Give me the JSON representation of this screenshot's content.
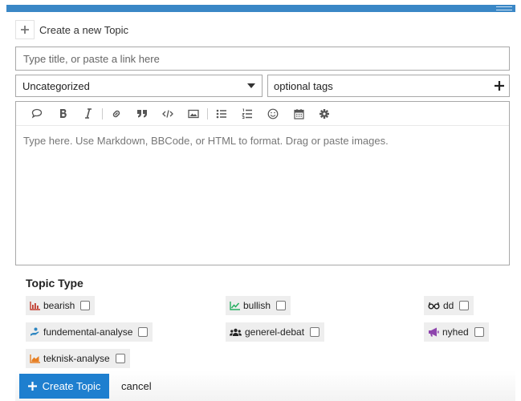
{
  "composer": {
    "header_label": "Create a new Topic",
    "title_placeholder": "Type title, or paste a link here",
    "category_selected": "Uncategorized",
    "tags_placeholder": "optional tags",
    "editor_placeholder": "Type here. Use Markdown, BBCode, or HTML to format. Drag or paste images."
  },
  "toolbar_icons": [
    "quote-icon",
    "bold-icon",
    "italic-icon",
    "link-icon",
    "blockquote-icon",
    "code-icon",
    "image-icon",
    "bullet-list-icon",
    "numbered-list-icon",
    "emoji-icon",
    "calendar-icon",
    "gear-icon"
  ],
  "topic_type": {
    "heading": "Topic Type",
    "options": [
      {
        "label": "bearish",
        "icon": "bar-chart-icon",
        "color": "#c0392b",
        "checked": false
      },
      {
        "label": "bullish",
        "icon": "line-chart-icon",
        "color": "#27ae60",
        "checked": false
      },
      {
        "label": "dd",
        "icon": "glasses-icon",
        "color": "#222222",
        "checked": false
      },
      {
        "label": "fundemental-analyse",
        "icon": "hand-icon",
        "color": "#2e86c1",
        "checked": false
      },
      {
        "label": "generel-debat",
        "icon": "users-icon",
        "color": "#222222",
        "checked": false
      },
      {
        "label": "nyhed",
        "icon": "megaphone-icon",
        "color": "#8e44ad",
        "checked": false
      },
      {
        "label": "teknisk-analyse",
        "icon": "area-chart-icon",
        "color": "#e67e22",
        "checked": false
      }
    ]
  },
  "actions": {
    "create_label": "Create Topic",
    "cancel_label": "cancel"
  },
  "colors": {
    "accent": "#1e7fcf",
    "topbar": "#3a87c6"
  }
}
